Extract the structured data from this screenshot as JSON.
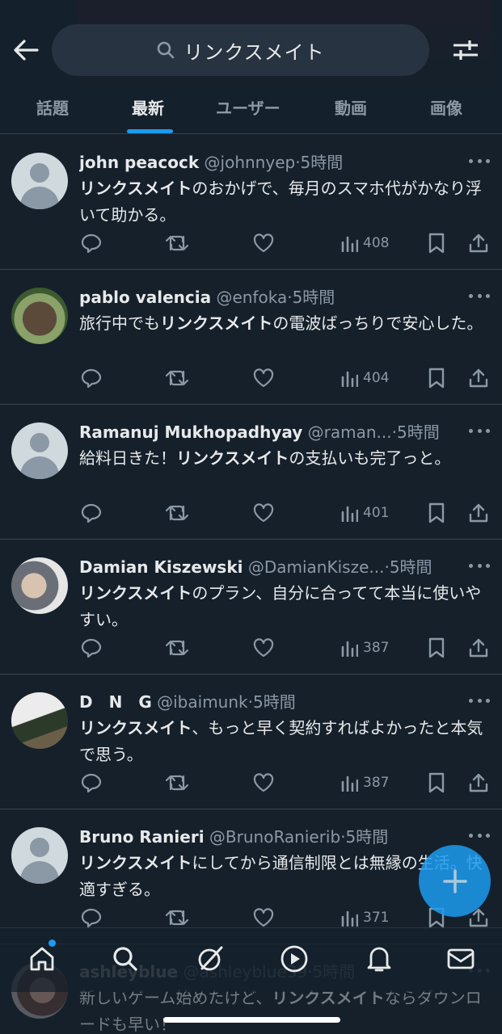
{
  "search": {
    "query": "リンクスメイト"
  },
  "tabs": [
    {
      "label": "話題"
    },
    {
      "label": "最新"
    },
    {
      "label": "ユーザー"
    },
    {
      "label": "動画"
    },
    {
      "label": "画像"
    }
  ],
  "active_tab": "最新",
  "tweets": [
    {
      "name": "john peacock",
      "handle": "@johnnyep",
      "time": "5時間",
      "text_bold": "リンクスメイト",
      "text_rest": "のおかげで、毎月のスマホ代がかなり浮いて助かる。",
      "views": "408",
      "avatar": "default"
    },
    {
      "name": "pablo valencia",
      "handle": "@enfoka",
      "time": "5時間",
      "text_pre": "旅行中でも",
      "text_bold": "リンクスメイト",
      "text_rest": "の電波ばっちりで安心した。",
      "views": "404",
      "avatar": "dog"
    },
    {
      "name": "Ramanuj Mukhopadhyay",
      "handle": "@raman...",
      "time": "5時間",
      "text_pre": "給料日きた！",
      "text_bold": "リンクスメイト",
      "text_rest": "の支払いも完了っと。",
      "views": "401",
      "avatar": "default"
    },
    {
      "name": "Damian Kiszewski",
      "handle": "@DamianKisze...",
      "time": "5時間",
      "text_bold": "リンクスメイト",
      "text_rest": "のプラン、自分に合ってて本当に使いやすい。",
      "views": "387",
      "avatar": "man"
    },
    {
      "name": "D　N　G",
      "handle": "@ibaimunk",
      "time": "5時間",
      "text_bold": "リンクスメイト",
      "text_rest": "、もっと早く契約すればよかったと本気で思う。",
      "views": "387",
      "avatar": "group"
    },
    {
      "name": "Bruno Ranieri",
      "handle": "@BrunoRanierib",
      "time": "5時間",
      "text_bold": "リンクスメイト",
      "text_rest": "にしてから通信制限とは無縁の生活。快適すぎる。",
      "views": "371",
      "avatar": "default"
    },
    {
      "name": "ashleyblue",
      "handle": "@ashleyblue39",
      "time": "5時間",
      "text_pre": "新しいゲーム始めたけど、",
      "text_bold": "リンクスメイト",
      "text_rest": "ならダウンロードも早い！",
      "avatar": "girl"
    }
  ],
  "separator": "·",
  "colors": {
    "background": "#15202b",
    "accent": "#1d9bf0",
    "muted": "#8b98a5"
  }
}
